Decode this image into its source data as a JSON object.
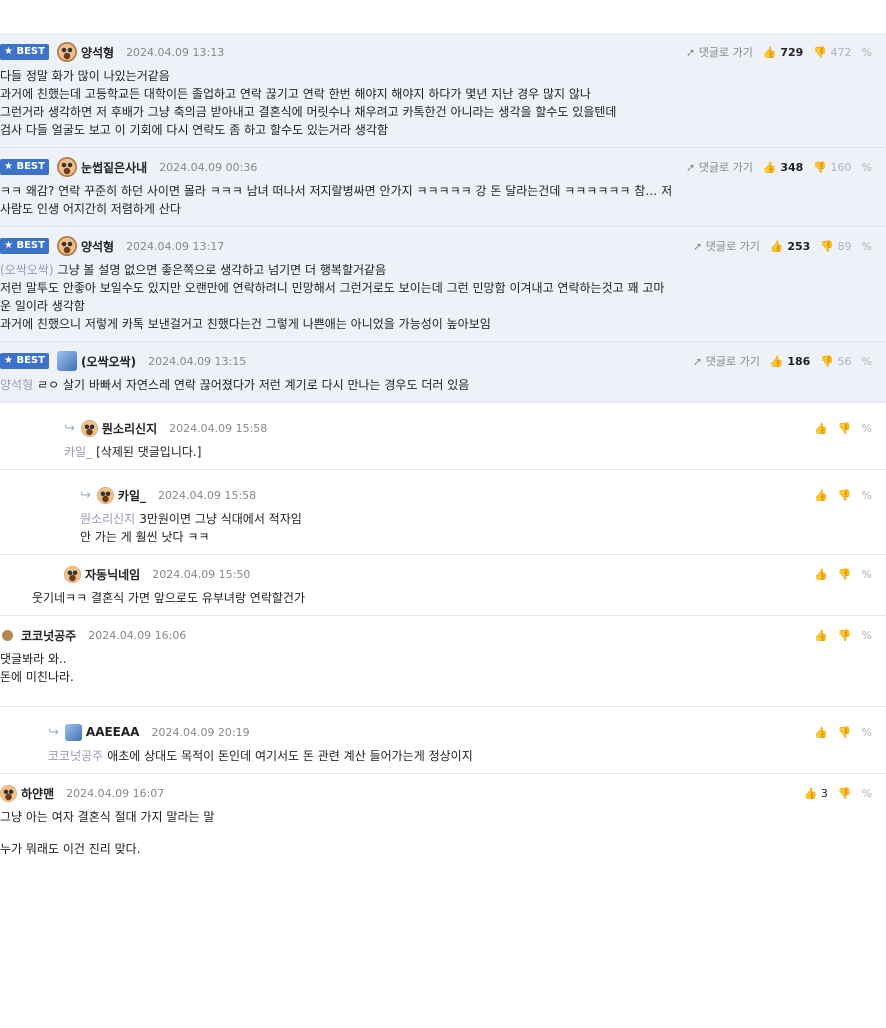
{
  "best_label": "★ BEST",
  "goto_label": "댓글로 가기",
  "comments": [
    {
      "nick": "양석형",
      "date": "2024.04.09 13:13",
      "up": "729",
      "down": "472",
      "lines": [
        "다들 정말 화가 많이 나있는거같음",
        "과거에 친했는데 고등학교든 대학이든 졸업하고 연락 끊기고 연락 한번 해야지 해야지 하다가 몇년 지난 경우 많지 않나",
        "그런거라 생각하면 저 후배가 그냥 축의금 받아내고 결혼식에 머릿수나 채우려고 카톡한건 아니라는 생각을 할수도 있을텐데",
        "검사 다들 얼굴도 보고 이 기회에 다시 연락도 좀 하고 할수도 있는거라 생각함"
      ]
    },
    {
      "nick": "눈썹짙은사내",
      "date": "2024.04.09 00:36",
      "up": "348",
      "down": "160",
      "lines": [
        "ㅋㅋ 왜감? 연락 꾸준히 하던 사이면 몰라 ㅋㅋㅋ 남녀 떠나서 저지랄병싸면 안가지 ㅋㅋㅋㅋㅋ 강 돈 달라는건데 ㅋㅋㅋㅋㅋㅋ 참… 저",
        "사람도 인생 어지간히 저렴하게 산다"
      ]
    },
    {
      "nick": "양석형",
      "date": "2024.04.09 13:17",
      "up": "253",
      "down": "89",
      "mention": "(오싹오싹)",
      "lines": [
        "그냥 볼 설명 없으면 좋은쪽으로 생각하고 넘기면 더 행복할거같음",
        "저런 말투도 안좋아 보일수도 있지만 오랜만에 연락하려니 민망해서 그런거로도 보이는데 그런 민망함 이겨내고 연락하는것고 꽤 고마",
        "운 일이라 생각함",
        "과거에 친했으니 저렇게 카톡 보낸걸거고 친했다는건 그렇게 나쁜애는 아니었을 가능성이 높아보임"
      ]
    },
    {
      "nick": "(오싹오싹)",
      "date": "2024.04.09 13:15",
      "up": "186",
      "down": "56",
      "mention": "양석형",
      "lines": [
        "ㄹㅇ 살기 바빠서 자연스레 연락 끊어졌다가 저런 계기로 다시 만나는 경우도 더러 있음"
      ]
    },
    {
      "nick": "뭔소리신지",
      "date": "2024.04.09 15:58",
      "up": "",
      "mention": "카일_",
      "lines": [
        "[삭제된 댓글입니다.]"
      ]
    },
    {
      "nick": "카일_",
      "date": "2024.04.09 15:58",
      "up": "",
      "mention": "뭔소리신지",
      "lines": [
        "3만원이면 그냥 식대에서 적자임",
        "안 가는 게 훨씬 낫다 ㅋㅋ"
      ]
    },
    {
      "nick": "자동닉네임",
      "date": "2024.04.09 15:50",
      "up": "",
      "lines": [
        "웃기네ㅋㅋ 결혼식 가면 앞으로도 유부녀랑 연락할건가"
      ]
    },
    {
      "nick": "코코넛공주",
      "date": "2024.04.09 16:06",
      "up": "",
      "lines": [
        "댓글봐라 와..",
        "돈에 미친나라."
      ]
    },
    {
      "nick": "AAEEAA",
      "date": "2024.04.09 20:19",
      "up": "",
      "mention": "코코넛공주",
      "lines": [
        "애초에 상대도 목적이 돈인데 여기서도 돈 관련 계산 들어가는게 정상이지"
      ]
    },
    {
      "nick": "하얀맨",
      "date": "2024.04.09 16:07",
      "up": "3",
      "lines": [
        "그냥 아는 여자 결혼식 절대 가지 말라는 말",
        "",
        "누가 뭐래도 이건 진리 맞다."
      ]
    }
  ]
}
